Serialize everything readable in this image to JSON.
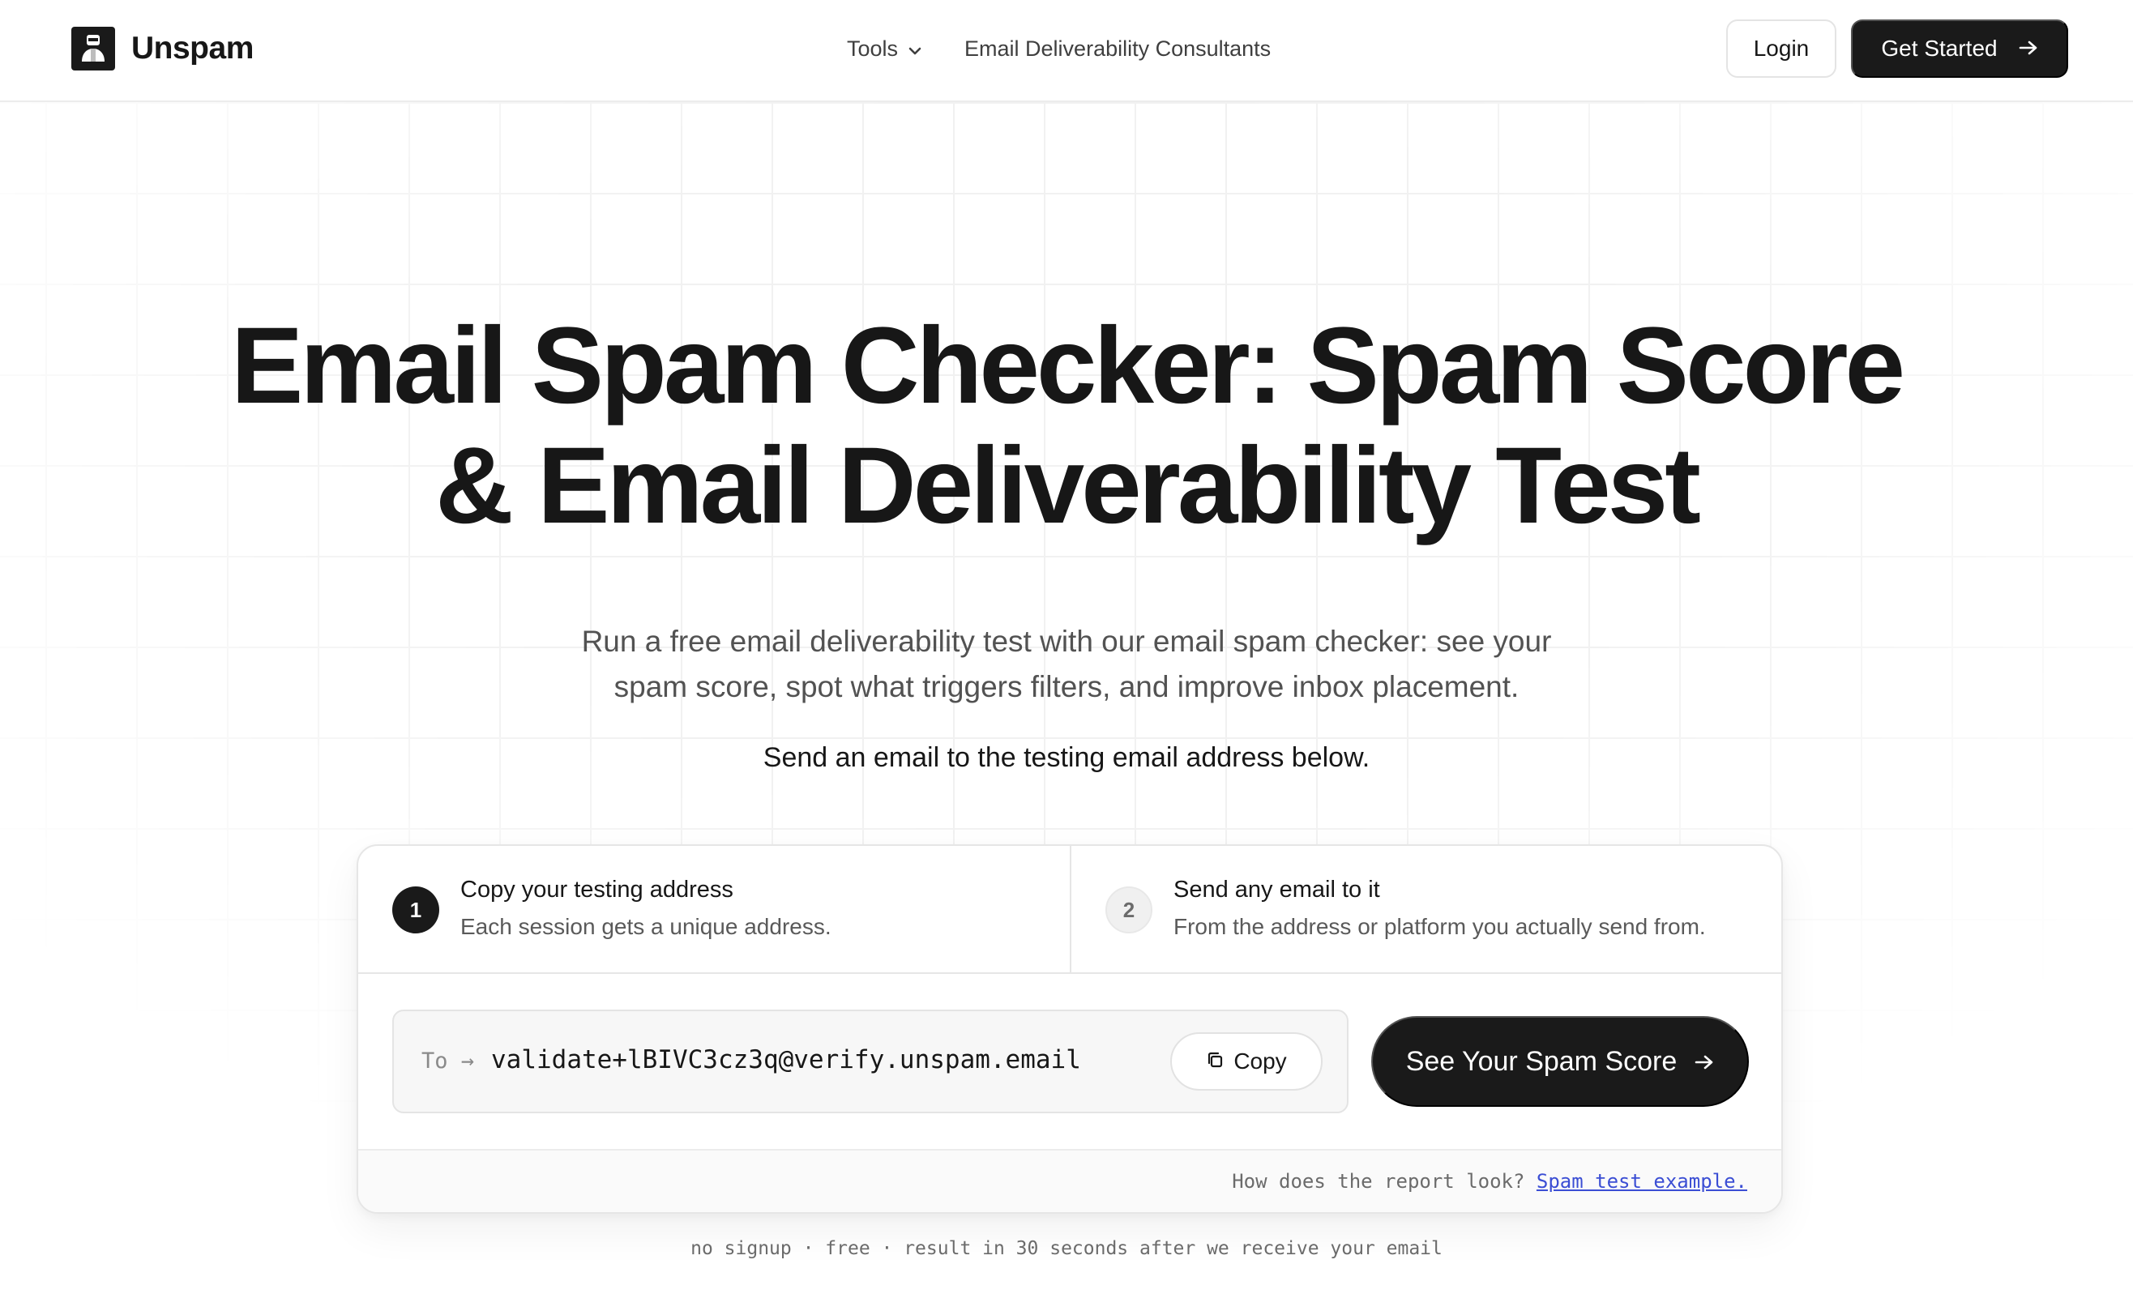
{
  "brand": {
    "name": "Unspam",
    "logo_icon": "unspam-logo-icon"
  },
  "nav": {
    "items": [
      {
        "label": "Tools",
        "icon": "chevron-down-icon"
      },
      {
        "label": "Email Deliverability Consultants"
      }
    ]
  },
  "header_actions": {
    "login_label": "Login",
    "get_started_label": "Get Started",
    "get_started_icon": "arrow-right-icon"
  },
  "hero": {
    "title_line1": "Email Spam Checker: Spam Score",
    "title_line2": "& Email Deliverability Test",
    "subtitle_line1": "Run a free email deliverability test with our email spam checker: see your",
    "subtitle_line2": "spam score, spot what triggers filters, and improve inbox placement.",
    "instruction": "Send an email to the testing email address below."
  },
  "steps": [
    {
      "number": "1",
      "title": "Copy your testing address",
      "description": "Each session gets a unique address.",
      "active": true
    },
    {
      "number": "2",
      "title": "Send any email to it",
      "description": "From the address or platform you actually send from.",
      "active": false
    }
  ],
  "address": {
    "prefix": "To →",
    "value": "validate+lBIVC3cz3q@verify.unspam.email",
    "copy_label": "Copy",
    "copy_icon": "copy-icon"
  },
  "score_button": {
    "label": "See Your Spam Score",
    "icon": "arrow-right-icon"
  },
  "card_footer": {
    "question": "How does the report look?",
    "link_label": "Spam test example."
  },
  "bottom_note": "no signup · free · result in 30 seconds after we receive your email",
  "colors": {
    "primary_dark": "#1a1a1a",
    "link": "#3b4ed4",
    "text_muted": "#525252",
    "border": "#e6e6e6"
  }
}
